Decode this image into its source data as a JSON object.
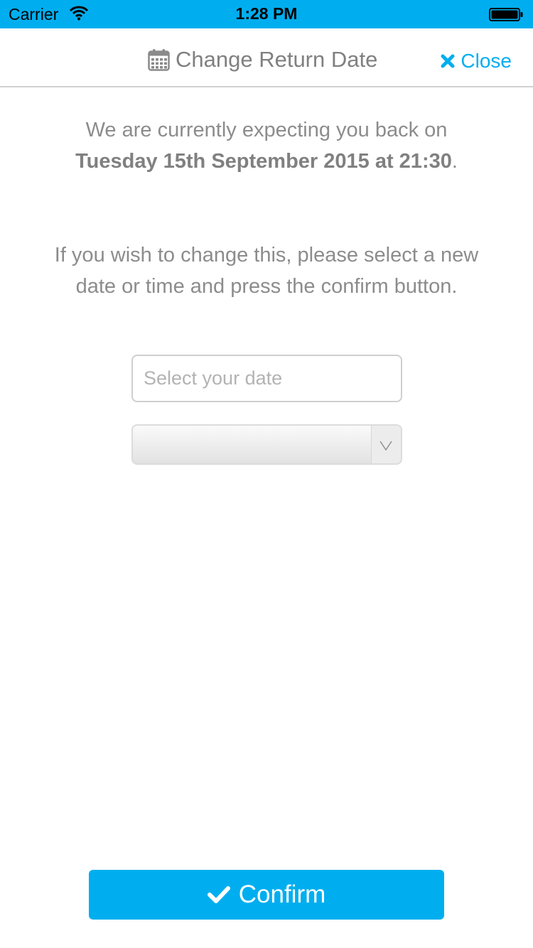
{
  "status_bar": {
    "carrier": "Carrier",
    "time": "1:28 PM",
    "background_color": "#00aeef"
  },
  "header": {
    "title": "Change Return Date",
    "title_icon": "calendar-icon",
    "close_label": "Close",
    "close_icon": "close-icon",
    "accent_color": "#00aeef"
  },
  "message": {
    "intro": "We are currently expecting you back on",
    "return_datetime": "Tuesday 15th September 2015 at 21:30",
    "trailing": ".",
    "instructions": "If you wish to change this, please select a new date or time and press the confirm button."
  },
  "date_field": {
    "value": "",
    "placeholder": "Select your date"
  },
  "time_select": {
    "selected_value": "",
    "arrow_icon": "chevron-down-icon"
  },
  "confirm_button": {
    "label": "Confirm",
    "icon": "check-icon",
    "background_color": "#00aeef"
  }
}
